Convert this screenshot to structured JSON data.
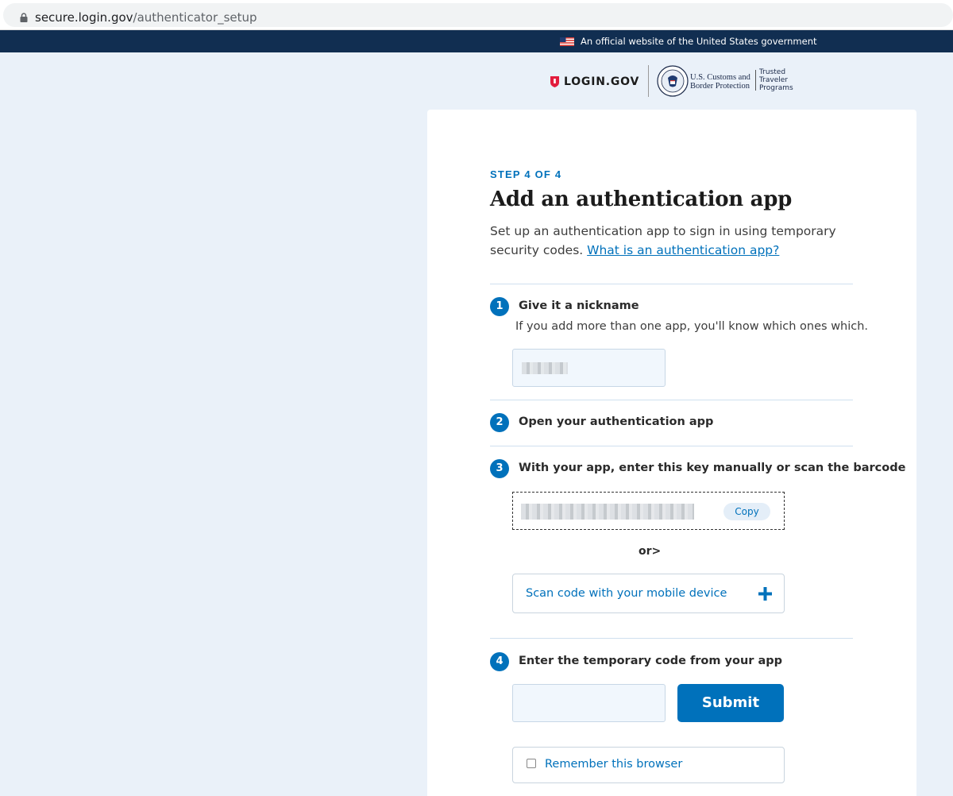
{
  "browser": {
    "url_host": "secure.login.gov",
    "url_path": "/authenticator_setup"
  },
  "banner": {
    "text": "An official website of the United States government"
  },
  "logos": {
    "login": "LOGIN.GOV",
    "cbp_line1": "U.S. Customs and",
    "cbp_line2": "Border Protection",
    "ttp_line1": "Trusted",
    "ttp_line2": "Traveler",
    "ttp_line3": "Programs"
  },
  "main": {
    "eyebrow": "STEP 4 OF 4",
    "title": "Add an authentication app",
    "intro": "Set up an authentication app to sign in using temporary security codes.",
    "help_link": "What is an authentication app?"
  },
  "steps": [
    {
      "number": "1",
      "label": "Give it a nickname",
      "help": "If you add more than one app, you'll know which ones which."
    },
    {
      "number": "2",
      "label": "Open your authentication app"
    },
    {
      "number": "3",
      "label": "With your app, enter this key manually or scan the barcode"
    },
    {
      "number": "4",
      "label": "Enter the temporary code from your app"
    }
  ],
  "key": {
    "copy_label": "Copy",
    "or_text": "or>",
    "scan_label": "Scan code with your mobile device"
  },
  "form": {
    "submit_label": "Submit",
    "remember_label": "Remember this browser"
  },
  "colors": {
    "accent": "#0071bb",
    "banner_bg": "#112e51",
    "page_bg": "#eaf1f9"
  }
}
